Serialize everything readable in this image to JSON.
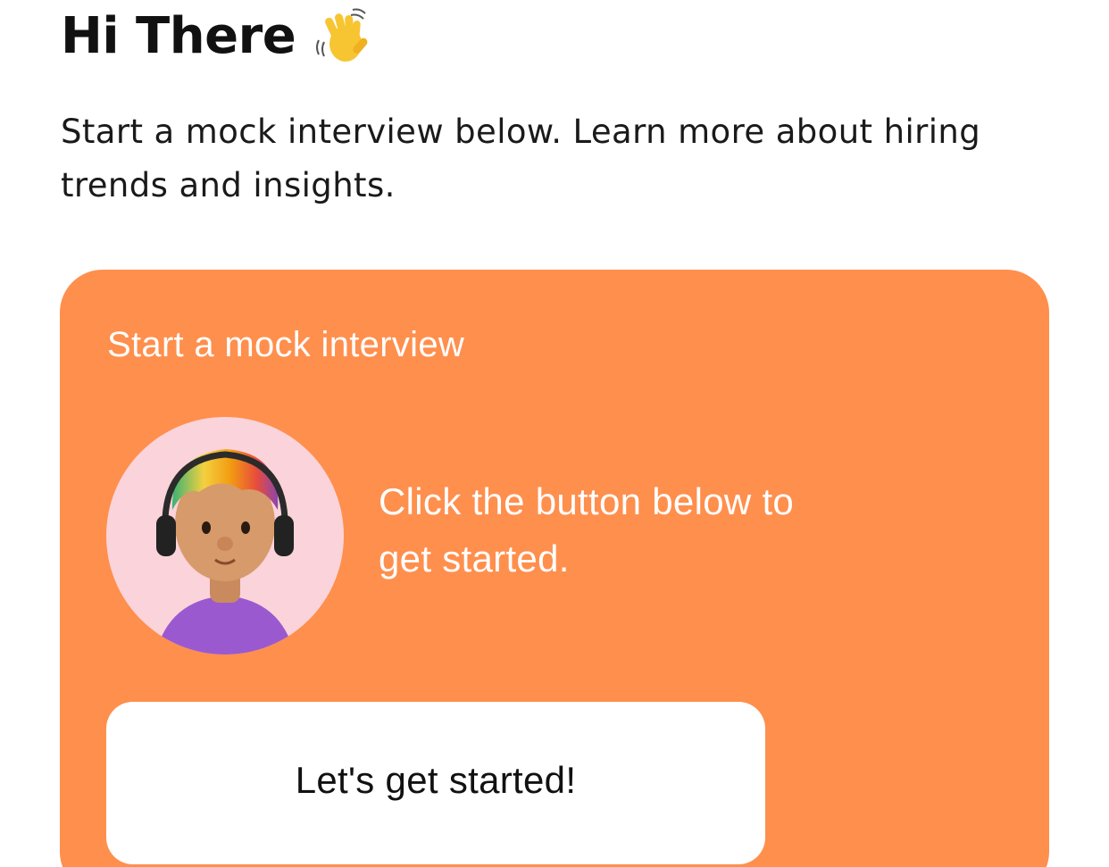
{
  "header": {
    "title": "Hi There",
    "icon": "waving-hand-icon"
  },
  "intro": {
    "text": "Start a mock interview below. Learn more about hiring trends and insights."
  },
  "card": {
    "title": "Start a mock interview",
    "body": "Click the button below to get started.",
    "button_label": "Let's get started!",
    "avatar": "avatar-headphones-icon"
  },
  "colors": {
    "card_background": "#FF8F4D",
    "avatar_background": "#FBD3DA",
    "button_background": "#FFFFFF",
    "text_dark": "#111111",
    "text_light": "#FFFFFF"
  }
}
